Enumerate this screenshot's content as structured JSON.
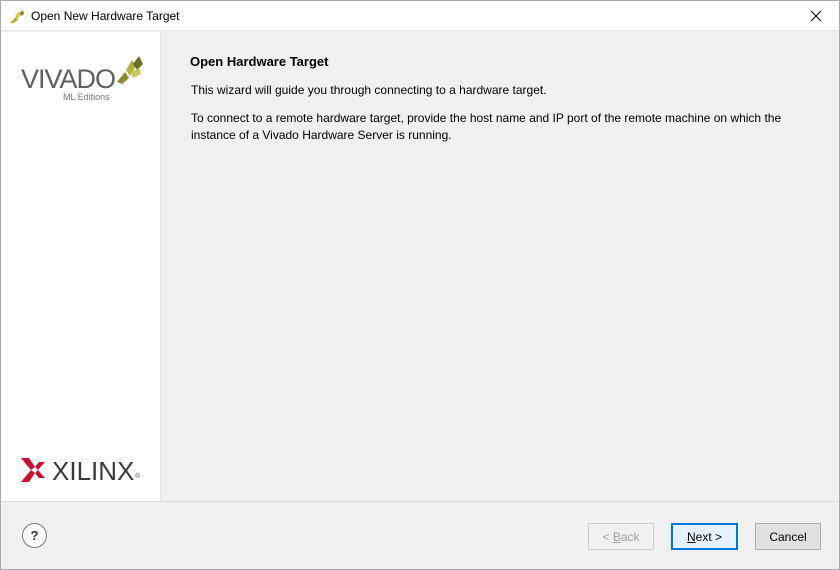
{
  "window": {
    "title": "Open New Hardware Target",
    "close_glyph": "✕"
  },
  "sidebar": {
    "vivado_word": "VIVADO",
    "vivado_sub": "ML Editions",
    "xilinx_word": "XILINX",
    "xilinx_reg": "®"
  },
  "content": {
    "heading": "Open Hardware Target",
    "para1": "This wizard will guide you through connecting to a hardware target.",
    "para2": "To connect to a remote hardware target, provide the host name and IP port of the remote machine on which the instance of a Vivado Hardware Server is running."
  },
  "footer": {
    "help_label": "?",
    "back": {
      "prefix": "< ",
      "mnemonic": "B",
      "rest": "ack"
    },
    "next": {
      "mnemonic": "N",
      "rest": "ext >"
    },
    "cancel_label": "Cancel"
  },
  "colors": {
    "accent": "#0078d7",
    "xilinx_red": "#c8102e",
    "vivado_olive": "#9d9a3c"
  }
}
